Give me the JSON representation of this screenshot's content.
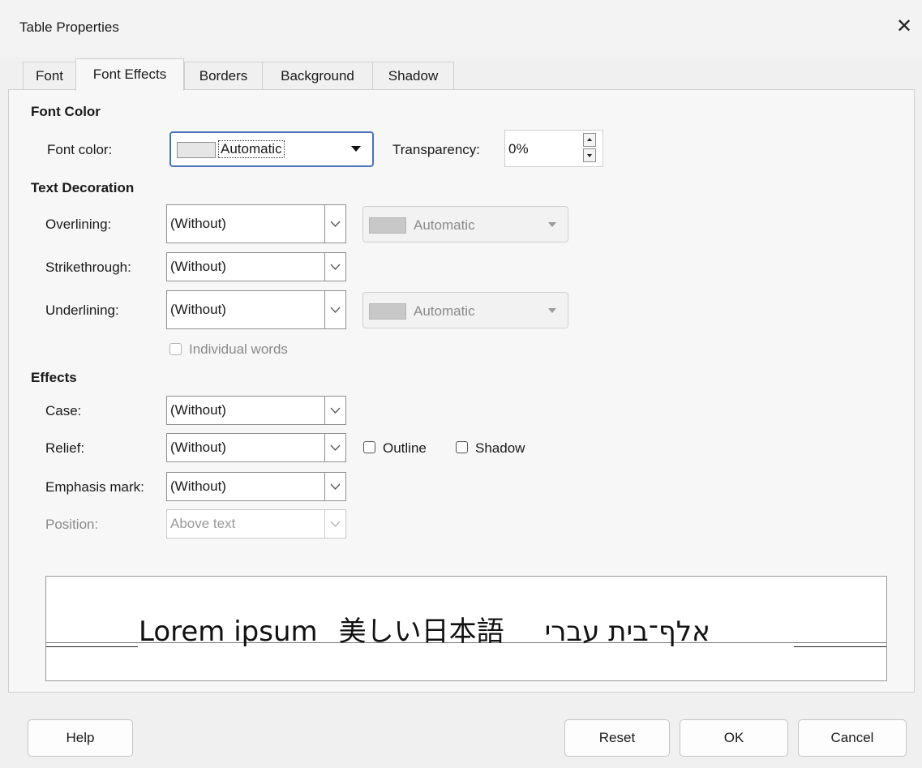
{
  "window": {
    "title": "Table Properties",
    "close_glyph": "✕"
  },
  "tabs": [
    {
      "label": "Font",
      "active": false
    },
    {
      "label": "Font Effects",
      "active": true
    },
    {
      "label": "Borders",
      "active": false
    },
    {
      "label": "Background",
      "active": false
    },
    {
      "label": "Shadow",
      "active": false
    }
  ],
  "font_color": {
    "heading": "Font Color",
    "label": "Font color:",
    "value": "Automatic",
    "transparency_label": "Transparency:",
    "transparency_value": "0%"
  },
  "text_decoration": {
    "heading": "Text Decoration",
    "overlining_label": "Overlining:",
    "overlining_value": "(Without)",
    "overlining_color": "Automatic",
    "strikethrough_label": "Strikethrough:",
    "strikethrough_value": "(Without)",
    "underlining_label": "Underlining:",
    "underlining_value": "(Without)",
    "underlining_color": "Automatic",
    "individual_words_label": "Individual words"
  },
  "effects": {
    "heading": "Effects",
    "case_label": "Case:",
    "case_value": "(Without)",
    "relief_label": "Relief:",
    "relief_value": "(Without)",
    "outline_label": "Outline",
    "shadow_label": "Shadow",
    "emphasis_label": "Emphasis mark:",
    "emphasis_value": "(Without)",
    "position_label": "Position:",
    "position_value": "Above text"
  },
  "preview": {
    "latin": "Lorem ipsum",
    "japanese": "美しい日本語",
    "hebrew": "אלף־בית עברי"
  },
  "buttons": {
    "help": "Help",
    "reset": "Reset",
    "ok": "OK",
    "cancel": "Cancel"
  }
}
